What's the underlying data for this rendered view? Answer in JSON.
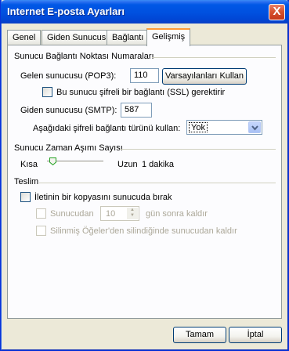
{
  "window": {
    "title": "Internet E-posta Ayarları",
    "close_glyph": "X"
  },
  "tabs": [
    "Genel",
    "Giden Sunucusu",
    "Bağlantı",
    "Gelişmiş"
  ],
  "ports": {
    "group_title": "Sunucu Bağlantı Noktası Numaraları",
    "pop3_label": "Gelen sunucusu (POP3):",
    "pop3_value": "110",
    "defaults_button": "Varsayılanları Kullan",
    "ssl_label": "Bu sunucu şifreli bir bağlantı (SSL) gerektirir",
    "smtp_label": "Giden sunucusu (SMTP):",
    "smtp_value": "587",
    "encryption_label": "Aşağıdaki şifreli bağlantı türünü kullan:",
    "encryption_value": "Yok"
  },
  "timeout": {
    "group_title": "Sunucu Zaman Aşımı Sayısı",
    "short_label": "Kısa",
    "long_label": "Uzun",
    "value_text": "1 dakika",
    "level": 0.05
  },
  "delivery": {
    "group_title": "Teslim",
    "leave_copy_label": "İletinin bir kopyasını sunucuda bırak",
    "remove_after_label": "Sunucudan",
    "remove_after_days": "10",
    "days_suffix": "gün sonra kaldır",
    "remove_deleted_label": "Silinmiş Öğeler'den silindiğinde sunucudan kaldır"
  },
  "buttons": {
    "ok": "Tamam",
    "cancel": "İptal"
  },
  "colors": {
    "titlebar": "#0054e3",
    "tab_highlight": "#ff9a35",
    "face": "#ece9d8"
  }
}
